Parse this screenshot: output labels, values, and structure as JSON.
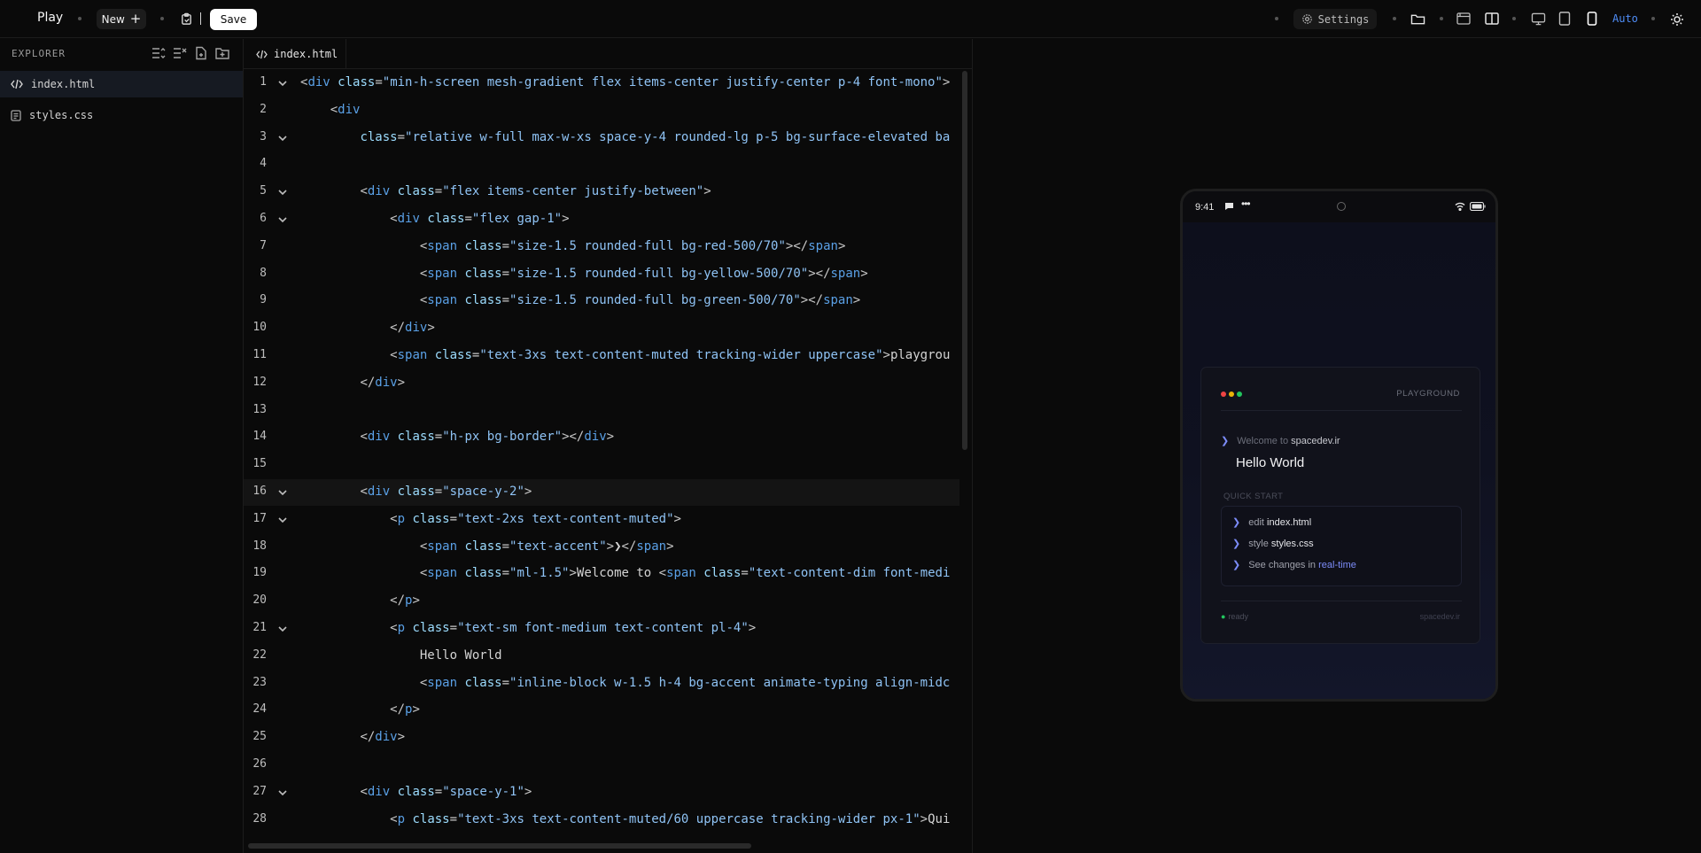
{
  "topbar": {
    "brand": "Play",
    "new_label": "New",
    "save_label": "Save",
    "settings_label": "Settings",
    "auto_label": "Auto"
  },
  "explorer": {
    "title": "EXPLORER",
    "files": [
      {
        "name": "index.html",
        "icon": "code-icon",
        "active": true
      },
      {
        "name": "styles.css",
        "icon": "css-file-icon",
        "active": false
      }
    ]
  },
  "editor": {
    "tab_label": "index.html",
    "lines": [
      {
        "n": "1",
        "fold": true
      },
      {
        "n": "2",
        "fold": false
      },
      {
        "n": "3",
        "fold": true
      },
      {
        "n": "4",
        "fold": false
      },
      {
        "n": "5",
        "fold": true
      },
      {
        "n": "6",
        "fold": true
      },
      {
        "n": "7",
        "fold": false
      },
      {
        "n": "8",
        "fold": false
      },
      {
        "n": "9",
        "fold": false
      },
      {
        "n": "10",
        "fold": false
      },
      {
        "n": "11",
        "fold": false
      },
      {
        "n": "12",
        "fold": false
      },
      {
        "n": "13",
        "fold": false
      },
      {
        "n": "14",
        "fold": false
      },
      {
        "n": "15",
        "fold": false
      },
      {
        "n": "16",
        "fold": true
      },
      {
        "n": "17",
        "fold": true
      },
      {
        "n": "18",
        "fold": false
      },
      {
        "n": "19",
        "fold": false
      },
      {
        "n": "20",
        "fold": false
      },
      {
        "n": "21",
        "fold": true
      },
      {
        "n": "22",
        "fold": false
      },
      {
        "n": "23",
        "fold": false
      },
      {
        "n": "24",
        "fold": false
      },
      {
        "n": "25",
        "fold": false
      },
      {
        "n": "26",
        "fold": false
      },
      {
        "n": "27",
        "fold": true
      },
      {
        "n": "28",
        "fold": false
      }
    ],
    "code": [
      "<div class=\"min-h-screen mesh-gradient flex items-center justify-center p-4 font-mono\">",
      "    <div",
      "        class=\"relative w-full max-w-xs space-y-4 rounded-lg p-5 bg-surface-elevated ba",
      "",
      "        <div class=\"flex items-center justify-between\">",
      "            <div class=\"flex gap-1\">",
      "                <span class=\"size-1.5 rounded-full bg-red-500/70\"></span>",
      "                <span class=\"size-1.5 rounded-full bg-yellow-500/70\"></span>",
      "                <span class=\"size-1.5 rounded-full bg-green-500/70\"></span>",
      "            </div>",
      "            <span class=\"text-3xs text-content-muted tracking-wider uppercase\">playgrou",
      "        </div>",
      "",
      "        <div class=\"h-px bg-border\"></div>",
      "",
      "        <div class=\"space-y-2\">",
      "            <p class=\"text-2xs text-content-muted\">",
      "                <span class=\"text-accent\">❯</span>",
      "                <span class=\"ml-1.5\">Welcome to <span class=\"text-content-dim font-medi",
      "            </p>",
      "            <p class=\"text-sm font-medium text-content pl-4\">",
      "                Hello World",
      "                <span class=\"inline-block w-1.5 h-4 bg-accent animate-typing align-midc",
      "            </p>",
      "        </div>",
      "",
      "        <div class=\"space-y-1\">",
      "            <p class=\"text-3xs text-content-muted/60 uppercase tracking-wider px-1\">Qui"
    ],
    "highlighted_line": "16"
  },
  "preview": {
    "status_time": "9:41",
    "card": {
      "playground_label": "PLAYGROUND",
      "welcome_prefix": "Welcome to",
      "welcome_site": "spacedev.ir",
      "hello": "Hello World",
      "quick_start": "QUICK START",
      "items": [
        {
          "prefix": "edit",
          "bold": "index.html",
          "link": ""
        },
        {
          "prefix": "style",
          "bold": "styles.css",
          "link": ""
        },
        {
          "prefix": "See changes in",
          "bold": "",
          "link": "real-time"
        }
      ],
      "ready": "ready",
      "host": "spacedev.ir"
    },
    "colors": {
      "accent": "#7c8cf8",
      "red": "#ef4444",
      "yellow": "#eab308",
      "green": "#22c55e"
    }
  }
}
